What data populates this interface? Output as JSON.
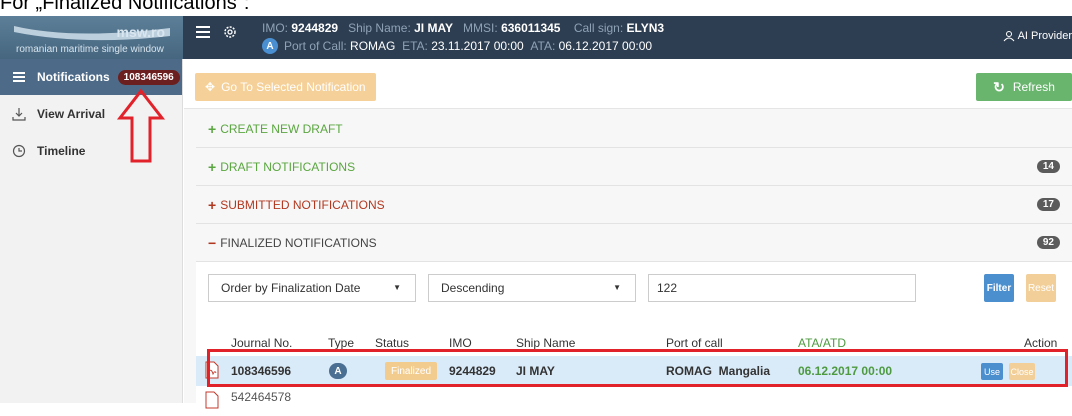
{
  "caption": "For „Finalized Notifications\":",
  "header": {
    "logo_text": "msw.ro",
    "logo_subtitle": "romanian maritime single window",
    "imo_label": "IMO:",
    "imo_value": "9244829",
    "ship_name_label": "Ship Name:",
    "ship_name_value": "JI MAY",
    "mmsi_label": "MMSI:",
    "mmsi_value": "636011345",
    "call_sign_label": "Call sign:",
    "call_sign_value": "ELYN3",
    "type_badge": "A",
    "port_label": "Port of Call:",
    "port_value": "ROMAG",
    "eta_label": "ETA:",
    "eta_value": "23.11.2017 00:00",
    "ata_label": "ATA:",
    "ata_value": "06.12.2017 00:00",
    "provider": "AI Provider"
  },
  "sidebar": {
    "items": [
      {
        "label": "Notifications",
        "icon": "list-icon",
        "badge": "108346596",
        "active": true
      },
      {
        "label": "View Arrival",
        "icon": "download-icon"
      },
      {
        "label": "Timeline",
        "icon": "clock-icon"
      }
    ]
  },
  "toolbar": {
    "goto_label": "Go To Selected Notification",
    "refresh_label": "Refresh"
  },
  "sections": [
    {
      "symbol": "+",
      "label": "CREATE NEW DRAFT",
      "color": "#5aa640"
    },
    {
      "symbol": "+",
      "label": "DRAFT NOTIFICATIONS",
      "count": "14",
      "color": "#5aa640"
    },
    {
      "symbol": "+",
      "label": "SUBMITTED NOTIFICATIONS",
      "count": "17",
      "color": "#b2371f"
    },
    {
      "symbol": "−",
      "label": "FINALIZED NOTIFICATIONS",
      "count": "92",
      "color": "#b2371f"
    }
  ],
  "filters": {
    "order_by": "Order by Finalization Date",
    "direction": "Descending",
    "search_value": "122",
    "filter_label": "Filter",
    "reset_label": "Reset"
  },
  "table": {
    "headers": [
      "Journal No.",
      "Type",
      "Status",
      "IMO",
      "Ship Name",
      "Port of call",
      "ATA/ATD",
      "Action"
    ],
    "rows": [
      {
        "journal": "108346596",
        "type": "A",
        "status": "Finalized",
        "imo": "9244829",
        "ship": "JI MAY",
        "port": "ROMAG  Mangalia",
        "ata": "06.12.2017 00:00",
        "use": "Use",
        "close": "Close"
      },
      {
        "journal": "542464578"
      }
    ]
  }
}
